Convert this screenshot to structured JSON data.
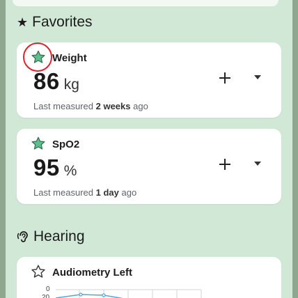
{
  "sections": {
    "favorites": {
      "title": "Favorites",
      "icon": "star-icon"
    },
    "hearing": {
      "title": "Hearing",
      "icon": "ear-icon"
    }
  },
  "cards": {
    "weight": {
      "name": "Weight",
      "value": "86",
      "unit": "kg",
      "measured_prefix": "Last measured",
      "measured_period": "2 weeks",
      "measured_suffix": "ago",
      "favorite": true
    },
    "spo2": {
      "name": "SpO2",
      "value": "95",
      "unit": "%",
      "measured_prefix": "Last measured",
      "measured_period": "1 day",
      "measured_suffix": "ago",
      "favorite": true
    },
    "audiometry_left": {
      "name": "Audiometry Left",
      "favorite": false,
      "axis_labels": [
        "0",
        "20"
      ]
    }
  },
  "colors": {
    "accent_green": "#5fbf8c",
    "highlight_red": "#e0202a",
    "chart_blue": "#4fa8d8"
  }
}
